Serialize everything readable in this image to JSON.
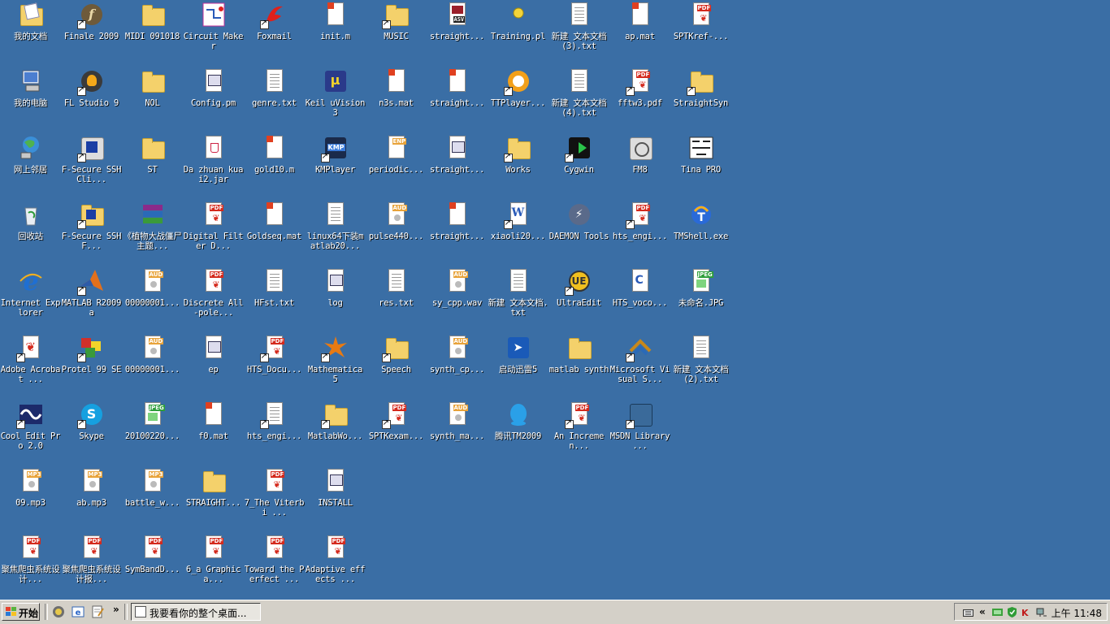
{
  "desktop": {
    "icons": [
      {
        "label": "我的文档",
        "kind": "mydocs",
        "shortcut": false
      },
      {
        "label": "我的电脑",
        "kind": "computer",
        "shortcut": false
      },
      {
        "label": "网上邻居",
        "kind": "network",
        "shortcut": false
      },
      {
        "label": "回收站",
        "kind": "recycle",
        "shortcut": false
      },
      {
        "label": "Internet Explorer",
        "kind": "ie",
        "shortcut": false
      },
      {
        "label": "Adobe Acrobat ...",
        "kind": "acrobat",
        "shortcut": true
      },
      {
        "label": "Cool Edit Pro 2.0",
        "kind": "cooledit",
        "shortcut": true
      },
      {
        "label": "09.mp3",
        "kind": "mp3",
        "shortcut": false
      },
      {
        "label": "聚焦爬虫系统设计...",
        "kind": "pdf",
        "shortcut": false
      },
      {
        "label": "Finale 2009",
        "kind": "finale",
        "shortcut": true
      },
      {
        "label": "FL Studio 9",
        "kind": "flstudio",
        "shortcut": true
      },
      {
        "label": "F-Secure SSH Cli...",
        "kind": "fsecure",
        "shortcut": true
      },
      {
        "label": "F-Secure SSH F...",
        "kind": "fsecurefolder",
        "shortcut": true
      },
      {
        "label": "MATLAB R2009a",
        "kind": "matlab",
        "shortcut": true
      },
      {
        "label": "Protel 99 SE",
        "kind": "protel",
        "shortcut": true
      },
      {
        "label": "Skype",
        "kind": "skype",
        "shortcut": true
      },
      {
        "label": "ab.mp3",
        "kind": "mp3",
        "shortcut": false
      },
      {
        "label": "聚焦爬虫系统设计报...",
        "kind": "pdf",
        "shortcut": false
      },
      {
        "label": "MIDI 091018",
        "kind": "folder",
        "shortcut": false
      },
      {
        "label": "NOL",
        "kind": "folder",
        "shortcut": false
      },
      {
        "label": "ST",
        "kind": "folder",
        "shortcut": false
      },
      {
        "label": "《植物大战僵尸主题...",
        "kind": "winrar",
        "shortcut": false
      },
      {
        "label": "00000001...",
        "kind": "aud",
        "shortcut": false
      },
      {
        "label": "00000001...",
        "kind": "aud",
        "shortcut": false
      },
      {
        "label": "20100220...",
        "kind": "jpg",
        "shortcut": false
      },
      {
        "label": "battle_w...",
        "kind": "mp3",
        "shortcut": false
      },
      {
        "label": "SymBandD...",
        "kind": "pdf",
        "shortcut": false
      },
      {
        "label": "Circuit Maker",
        "kind": "circuit",
        "shortcut": false
      },
      {
        "label": "Config.pm",
        "kind": "app",
        "shortcut": false
      },
      {
        "label": "Da zhuan kuai2.jar",
        "kind": "jar",
        "shortcut": false
      },
      {
        "label": "Digital Filter D...",
        "kind": "pdf",
        "shortcut": false
      },
      {
        "label": "Discrete All-pole...",
        "kind": "pdf",
        "shortcut": false
      },
      {
        "label": "ep",
        "kind": "app",
        "shortcut": false
      },
      {
        "label": "f0.mat",
        "kind": "mat",
        "shortcut": false
      },
      {
        "label": "STRAIGHT...",
        "kind": "folder",
        "shortcut": false
      },
      {
        "label": "6_a Graphica...",
        "kind": "pdf",
        "shortcut": false
      },
      {
        "label": "Foxmail",
        "kind": "foxmail",
        "shortcut": true
      },
      {
        "label": "genre.txt",
        "kind": "txt",
        "shortcut": false
      },
      {
        "label": "gold10.m",
        "kind": "mat",
        "shortcut": false
      },
      {
        "label": "Goldseq.mat",
        "kind": "mat",
        "shortcut": false
      },
      {
        "label": "HFst.txt",
        "kind": "txt",
        "shortcut": false
      },
      {
        "label": "HTS_Docu...",
        "kind": "pdf",
        "shortcut": true
      },
      {
        "label": "hts_engi...",
        "kind": "txt",
        "shortcut": true
      },
      {
        "label": "7_The Viterbi ...",
        "kind": "pdf",
        "shortcut": false
      },
      {
        "label": "Toward the Perfect ...",
        "kind": "pdf",
        "shortcut": false
      },
      {
        "label": "init.m",
        "kind": "mat",
        "shortcut": false
      },
      {
        "label": "Keil uVision3",
        "kind": "keil",
        "shortcut": false
      },
      {
        "label": "KMPlayer",
        "kind": "kmplayer",
        "shortcut": true
      },
      {
        "label": "linux64下装matlab20...",
        "kind": "txt",
        "shortcut": false
      },
      {
        "label": "log",
        "kind": "app",
        "shortcut": false
      },
      {
        "label": "Mathematica 5",
        "kind": "mathematica",
        "shortcut": true
      },
      {
        "label": "MatlabWo...",
        "kind": "folder",
        "shortcut": true
      },
      {
        "label": "INSTALL",
        "kind": "app",
        "shortcut": false
      },
      {
        "label": "Adaptive effects ...",
        "kind": "pdf",
        "shortcut": false
      },
      {
        "label": "MUSIC",
        "kind": "folder",
        "shortcut": true
      },
      {
        "label": "n3s.mat",
        "kind": "mat",
        "shortcut": false
      },
      {
        "label": "periodic...",
        "kind": "enp",
        "shortcut": false
      },
      {
        "label": "pulse440...",
        "kind": "aud",
        "shortcut": false
      },
      {
        "label": "res.txt",
        "kind": "txt",
        "shortcut": false
      },
      {
        "label": "Speech",
        "kind": "folder",
        "shortcut": true
      },
      {
        "label": "SPTKexam...",
        "kind": "pdf",
        "shortcut": true
      },
      {
        "label": "straight...",
        "kind": "asv",
        "shortcut": false
      },
      {
        "label": "straight...",
        "kind": "mat",
        "shortcut": false
      },
      {
        "label": "straight...",
        "kind": "app",
        "shortcut": false
      },
      {
        "label": "straight...",
        "kind": "mat",
        "shortcut": false
      },
      {
        "label": "sy_cpp.wav",
        "kind": "aud",
        "shortcut": false
      },
      {
        "label": "synth_cp...",
        "kind": "aud",
        "shortcut": false
      },
      {
        "label": "synth_ma...",
        "kind": "aud",
        "shortcut": false
      },
      {
        "label": "Training.pl",
        "kind": "perl",
        "shortcut": false
      },
      {
        "label": "TTPlayer...",
        "kind": "ttplayer",
        "shortcut": true
      },
      {
        "label": "Works",
        "kind": "folder",
        "shortcut": true
      },
      {
        "label": "xiaoli20...",
        "kind": "word",
        "shortcut": true
      },
      {
        "label": "新建 文本文档.txt",
        "kind": "txt",
        "shortcut": false
      },
      {
        "label": "启动迅雷5",
        "kind": "xunlei",
        "shortcut": false
      },
      {
        "label": "腾讯TM2009",
        "kind": "qq",
        "shortcut": false
      },
      {
        "label": "新建 文本文档 (3).txt",
        "kind": "txt",
        "shortcut": false
      },
      {
        "label": "新建 文本文档 (4).txt",
        "kind": "txt",
        "shortcut": false
      },
      {
        "label": "Cygwin",
        "kind": "cygwin",
        "shortcut": true
      },
      {
        "label": "DAEMON Tools",
        "kind": "daemon",
        "shortcut": false
      },
      {
        "label": "UltraEdit",
        "kind": "ultraedit",
        "shortcut": true
      },
      {
        "label": "matlab synth",
        "kind": "folder",
        "shortcut": false
      },
      {
        "label": "An Incremen...",
        "kind": "pdf",
        "shortcut": true
      },
      {
        "label": "ap.mat",
        "kind": "mat",
        "shortcut": false
      },
      {
        "label": "fftw3.pdf",
        "kind": "pdf",
        "shortcut": true
      },
      {
        "label": "FM8",
        "kind": "fm8",
        "shortcut": false
      },
      {
        "label": "hts_engi...",
        "kind": "pdf",
        "shortcut": true
      },
      {
        "label": "HTS_voco...",
        "kind": "cfile",
        "shortcut": false
      },
      {
        "label": "Microsoft Visual S...",
        "kind": "vs",
        "shortcut": true
      },
      {
        "label": "MSDN Library ...",
        "kind": "msdn",
        "shortcut": true
      },
      {
        "label": "SPTKref-...",
        "kind": "pdf",
        "shortcut": false
      },
      {
        "label": "StraightSyn",
        "kind": "folder",
        "shortcut": true
      },
      {
        "label": "Tina PRO",
        "kind": "tina",
        "shortcut": false
      },
      {
        "label": "TMShell.exe",
        "kind": "tmshell",
        "shortcut": false
      },
      {
        "label": "未命名.JPG",
        "kind": "jpg",
        "shortcut": false
      },
      {
        "label": "新建 文本文档 (2).txt",
        "kind": "txt",
        "shortcut": false
      }
    ],
    "columns": [
      9,
      9,
      9,
      9,
      9,
      9,
      7,
      7,
      7,
      7,
      7,
      6
    ]
  },
  "taskbar": {
    "start_label": "开始",
    "quick_launch": [
      "show-desktop-icon",
      "ie-icon",
      "notepad-icon"
    ],
    "more_label": "»",
    "task_label": "我要看你的整个桌面...",
    "tray_expand": "«",
    "clock": "上午 11:48"
  }
}
